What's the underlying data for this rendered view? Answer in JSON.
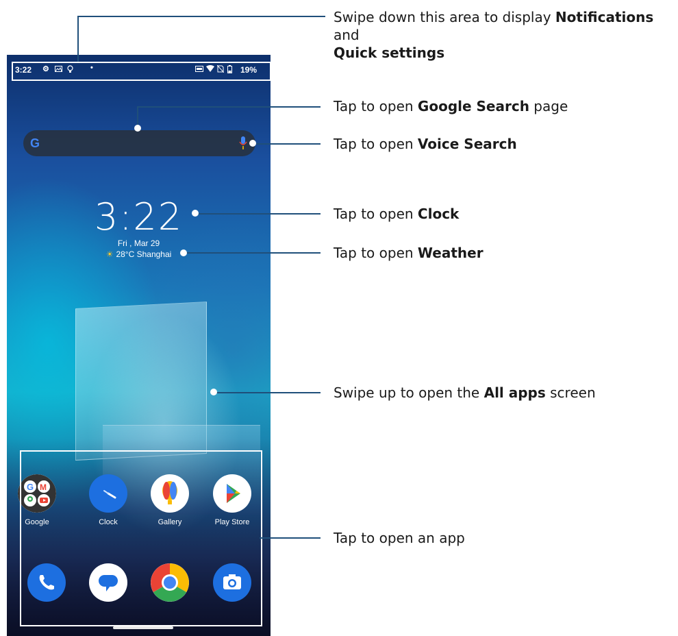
{
  "status_bar": {
    "time": "3:22",
    "battery": "19%"
  },
  "clock": {
    "time": "3:22",
    "date": "Fri , Mar 29"
  },
  "weather": {
    "text": "28°C Shanghai"
  },
  "apps_row1": [
    {
      "label": "Google",
      "icon": "google-folder-icon"
    },
    {
      "label": "Clock",
      "icon": "clock-icon"
    },
    {
      "label": "Gallery",
      "icon": "gallery-icon"
    },
    {
      "label": "Play Store",
      "icon": "play-store-icon"
    }
  ],
  "dock": [
    {
      "icon": "phone-icon"
    },
    {
      "icon": "messages-icon"
    },
    {
      "icon": "chrome-icon"
    },
    {
      "icon": "camera-icon"
    }
  ],
  "callouts": {
    "notifications": {
      "pre": "Swipe down this area to display ",
      "b1": "Notifications",
      "mid": " and",
      "b2": "Quick settings"
    },
    "google_search": {
      "pre": "Tap to open ",
      "b": "Google Search",
      "post": " page"
    },
    "voice_search": {
      "pre": "Tap to open ",
      "b": "Voice Search",
      "post": ""
    },
    "clock": {
      "pre": "Tap to open ",
      "b": "Clock",
      "post": ""
    },
    "weather": {
      "pre": "Tap to open ",
      "b": "Weather",
      "post": ""
    },
    "all_apps": {
      "pre": "Swipe up to open the ",
      "b": "All apps",
      "post": " screen"
    },
    "open_app": {
      "pre": "Tap to open an app",
      "b": "",
      "post": ""
    }
  },
  "colors": {
    "callout_line": "#1f4f7a",
    "google_blue": "#4285f4",
    "google_red": "#ea4335",
    "google_yellow": "#fbbc05",
    "google_green": "#34a853"
  }
}
